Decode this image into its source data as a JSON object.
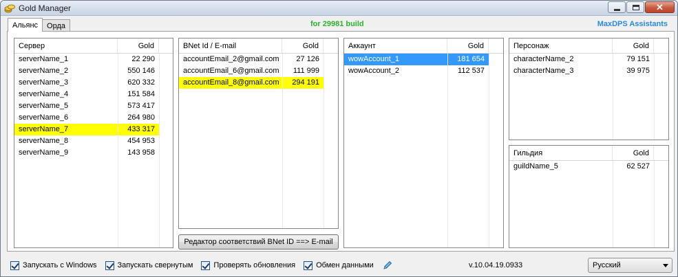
{
  "window": {
    "title": "Gold Manager"
  },
  "tabs": [
    {
      "label": "Альянс",
      "active": true
    },
    {
      "label": "Орда",
      "active": false
    }
  ],
  "header": {
    "build": "for 29981 build",
    "brand": "MaxDPS Assistants",
    "build_color": "#2db32d",
    "brand_color": "#2b8ae0"
  },
  "servers": {
    "col_name": "Сервер",
    "col_gold": "Gold",
    "rows": [
      {
        "name": "serverName_1",
        "gold": "22 290"
      },
      {
        "name": "serverName_2",
        "gold": "550 146"
      },
      {
        "name": "serverName_3",
        "gold": "620 332"
      },
      {
        "name": "serverName_4",
        "gold": "151 584"
      },
      {
        "name": "serverName_5",
        "gold": "573 417"
      },
      {
        "name": "serverName_6",
        "gold": "264 980"
      },
      {
        "name": "serverName_7",
        "gold": "433 317",
        "highlight": "yellow"
      },
      {
        "name": "serverName_8",
        "gold": "454 953"
      },
      {
        "name": "serverName_9",
        "gold": "143 958"
      }
    ]
  },
  "bnet": {
    "col_name": "BNet Id / E-mail",
    "col_gold": "Gold",
    "rows": [
      {
        "name": "accountEmail_2@gmail.com",
        "gold": "27 126"
      },
      {
        "name": "accountEmail_6@gmail.com",
        "gold": "111 999"
      },
      {
        "name": "accountEmail_8@gmail.com",
        "gold": "294 191",
        "highlight": "yellow"
      }
    ]
  },
  "accounts": {
    "col_name": "Аккаунт",
    "col_gold": "Gold",
    "rows": [
      {
        "name": "wowAccount_1",
        "gold": "181 654",
        "highlight": "blue"
      },
      {
        "name": "wowAccount_2",
        "gold": "112 537"
      }
    ]
  },
  "characters": {
    "col_name": "Персонаж",
    "col_gold": "Gold",
    "rows": [
      {
        "name": "characterName_2",
        "gold": "79 151"
      },
      {
        "name": "characterName_3",
        "gold": "39 975"
      }
    ]
  },
  "guilds": {
    "col_name": "Гильдия",
    "col_gold": "Gold",
    "rows": [
      {
        "name": "guildName_5",
        "gold": "62 527"
      }
    ]
  },
  "editor_button": "Редактор соответствий BNet ID ==> E-mail",
  "options": [
    {
      "label": "Запускать с Windows",
      "checked": true
    },
    {
      "label": "Запускать свернутым",
      "checked": true
    },
    {
      "label": "Проверять обновления",
      "checked": true
    },
    {
      "label": "Обмен данными",
      "checked": true
    }
  ],
  "version": "v.10.04.19.0933",
  "language": {
    "selected": "Русский"
  },
  "colors": {
    "highlight_yellow": "#ffff00",
    "selection_blue": "#3399ff"
  }
}
